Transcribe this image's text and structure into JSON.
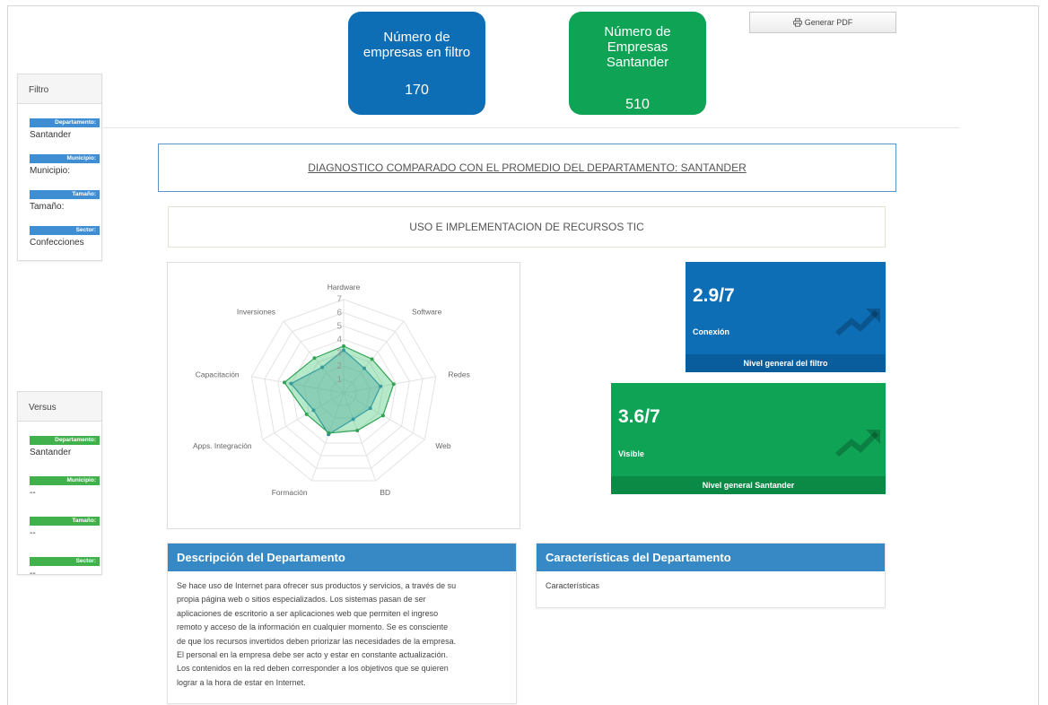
{
  "cards": {
    "filtro": {
      "label": "Número de empresas en filtro",
      "value": "170"
    },
    "santander": {
      "label": "Número de Empresas Santander",
      "value": "510"
    }
  },
  "pdf_button": {
    "label": "Generar PDF",
    "icon": "printer-icon"
  },
  "filter_panel": {
    "title": "Filtro",
    "items": [
      {
        "tag": "Departamento:",
        "value": "Santander"
      },
      {
        "tag": "Municipio:",
        "value": "Municipio:"
      },
      {
        "tag": "Tamaño:",
        "value": "Tamaño:"
      },
      {
        "tag": "Sector:",
        "value": "Confecciones"
      }
    ]
  },
  "versus_panel": {
    "title": "Versus",
    "items": [
      {
        "tag": "Departamento:",
        "value": "Santander"
      },
      {
        "tag": "Municipio:",
        "value": "--"
      },
      {
        "tag": "Tamaño:",
        "value": "--"
      },
      {
        "tag": "Sector:",
        "value": "--"
      }
    ]
  },
  "diag_title": "DIAGNOSTICO COMPARADO CON EL PROMEDIO DEL DEPARTAMENTO: SANTANDER",
  "section_title": "USO E IMPLEMENTACION DE RECURSOS TIC",
  "chart_data": {
    "type": "radar",
    "categories": [
      "Hardware",
      "Software",
      "Redes",
      "Web",
      "BD",
      "Formación",
      "Apps. Integración",
      "Capacitación",
      "Inversiones"
    ],
    "scale_labels": [
      "1",
      "2",
      "3",
      "4",
      "5",
      "6",
      "7"
    ],
    "rmax": 7,
    "series": [
      {
        "values": [
          3.2,
          2.4,
          2.8,
          2.3,
          2.1,
          3.3,
          2.6,
          4.0,
          2.5
        ],
        "color": "#2c7fb8",
        "fill": "rgba(95,160,185,0.45)"
      },
      {
        "values": [
          3.5,
          3.3,
          3.8,
          3.4,
          3.0,
          3.2,
          3.2,
          4.5,
          3.4
        ],
        "color": "#31a354",
        "fill": "rgba(70,200,120,0.4)"
      }
    ]
  },
  "kpis": {
    "filtro": {
      "value": "2.9/7",
      "sub": "Conexión",
      "footer": "Nivel general del filtro",
      "icon": "trend-up-icon"
    },
    "santander": {
      "value": "3.6/7",
      "sub": "Visible",
      "footer": "Nivel general Santander",
      "icon": "trend-up-icon"
    }
  },
  "description": {
    "title": "Descripción del Departamento",
    "lines": [
      "Se hace uso de Internet para ofrecer sus productos y servicios, a través de su",
      "propia página web o sitios especializados. Los sistemas pasan de ser",
      "aplicaciones de escritorio a ser aplicaciones web que permiten el ingreso",
      "remoto y acceso de la información en cualquier momento. Se es consciente",
      "de que los recursos invertidos deben priorizar las necesidades de la empresa.",
      "El personal en la empresa debe ser acto y estar en constante actualización.",
      "Los contenidos en la red deben corresponder a los objetivos que se quieren",
      "lograr a la hora de estar en Internet."
    ]
  },
  "characteristics": {
    "title": "Características del Departamento",
    "text": "Características"
  },
  "colors": {
    "blue": "#0d6eb5",
    "green": "#0fa455",
    "header_blue": "#3789c5"
  }
}
